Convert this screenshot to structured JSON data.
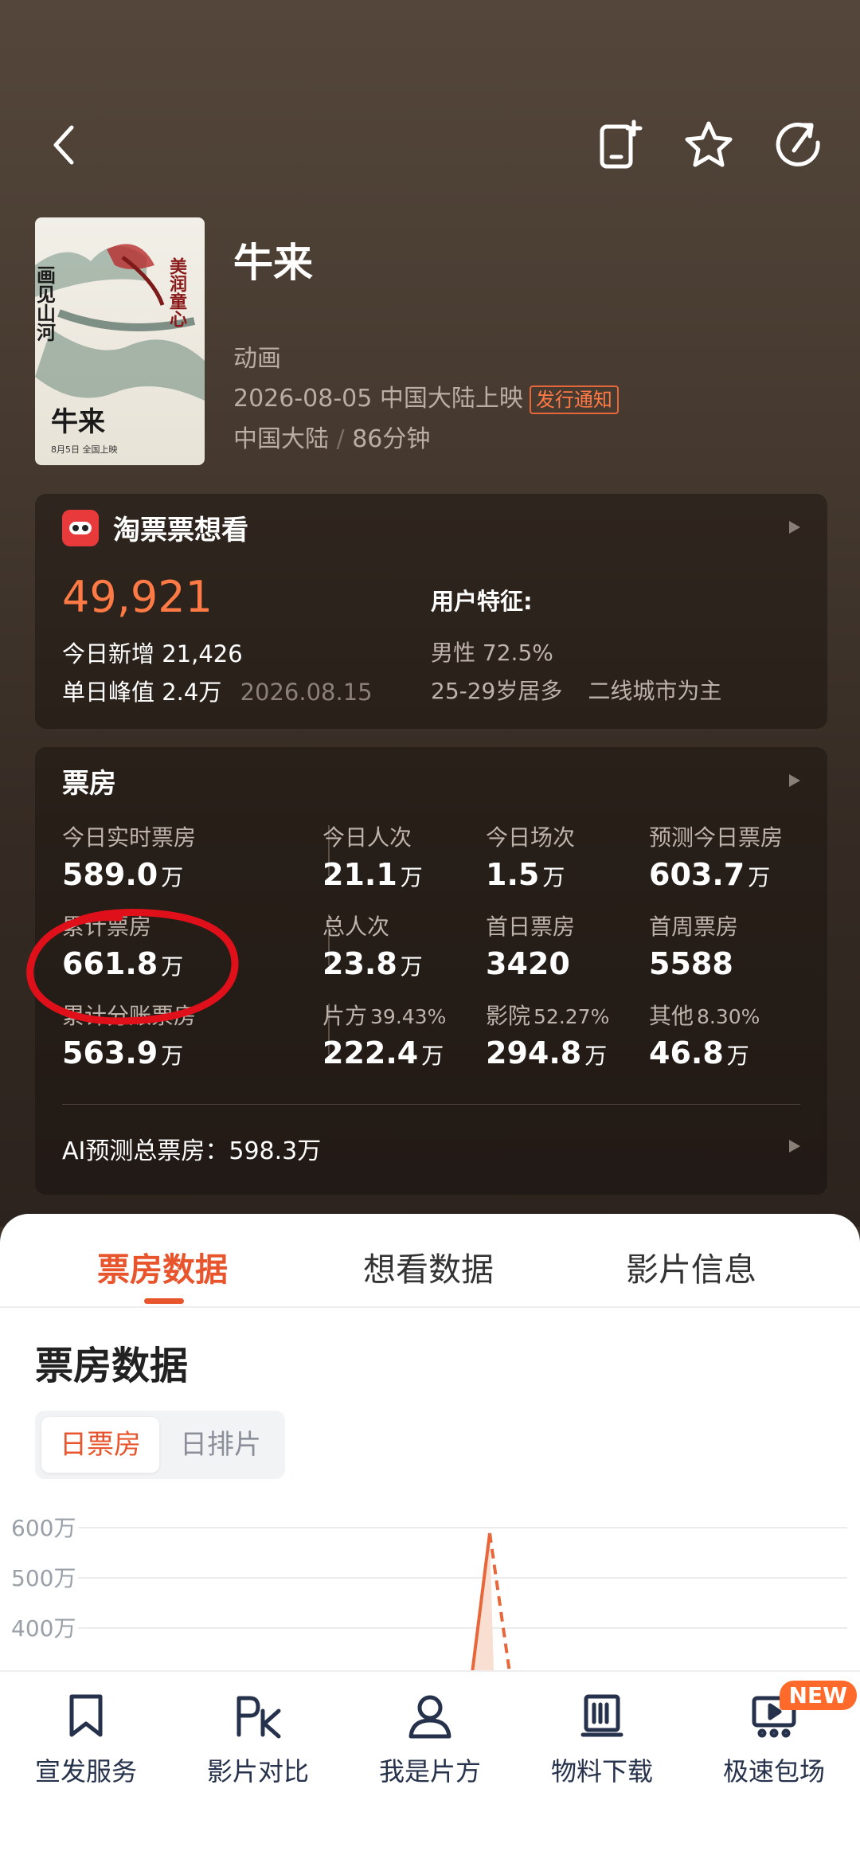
{
  "movie": {
    "title": "牛来",
    "genre": "动画",
    "release": "2026-08-05 中国大陆上映",
    "notice_badge": "发行通知",
    "region": "中国大陆",
    "region_sep": "/",
    "duration": "86分钟",
    "poster_text": {
      "left": "画见山河",
      "right": "美润童心",
      "title": "牛来",
      "date": "8月5日 全国上映"
    }
  },
  "want": {
    "title": "淘票票想看",
    "total": "49,921",
    "today_label": "今日新增",
    "today_value": "21,426",
    "peak_label": "单日峰值",
    "peak_value": "2.4万",
    "peak_date": "2026.08.15",
    "features_label": "用户特征:",
    "male_label": "男性",
    "male_value": "72.5%",
    "age": "25-29岁居多",
    "city": "二线城市为主"
  },
  "boxoffice": {
    "title": "票房",
    "stats": {
      "realtime": {
        "label": "今日实时票房",
        "value": "589.0",
        "unit": "万"
      },
      "today_people": {
        "label": "今日人次",
        "value": "21.1",
        "unit": "万"
      },
      "today_shows": {
        "label": "今日场次",
        "value": "1.5",
        "unit": "万"
      },
      "forecast_today": {
        "label": "预测今日票房",
        "value": "603.7",
        "unit": "万"
      },
      "cumulative": {
        "label": "累计票房",
        "value": "661.8",
        "unit": "万"
      },
      "total_people": {
        "label": "总人次",
        "value": "23.8",
        "unit": "万"
      },
      "first_day": {
        "label": "首日票房",
        "value": "3420"
      },
      "first_week": {
        "label": "首周票房",
        "value": "5588"
      },
      "split": {
        "label": "累计分账票房",
        "value": "563.9",
        "unit": "万"
      },
      "producer": {
        "label": "片方",
        "pct": "39.43%",
        "value": "222.4",
        "unit": "万"
      },
      "cinema": {
        "label": "影院",
        "pct": "52.27%",
        "value": "294.8",
        "unit": "万"
      },
      "other": {
        "label": "其他",
        "pct": "8.30%",
        "value": "46.8",
        "unit": "万"
      }
    },
    "ai_forecast": "AI预测总票房：598.3万"
  },
  "tabs": [
    "票房数据",
    "想看数据",
    "影片信息"
  ],
  "section_title": "票房数据",
  "segment": {
    "on": "日票房",
    "off": "日排片"
  },
  "chart_data": {
    "type": "line",
    "title": "",
    "xlabel": "",
    "ylabel": "",
    "y_ticks": [
      "600万",
      "500万",
      "400万"
    ],
    "ylim_visible": [
      350,
      600
    ],
    "y_unit": "万",
    "series": [
      {
        "style": "solid",
        "values": [
          589.0
        ]
      },
      {
        "style": "dashed",
        "values": [
          603.7
        ]
      }
    ],
    "accent_color": "#e8673a"
  },
  "bottom_nav": [
    {
      "label": "宣发服务",
      "icon": "bookmark-icon"
    },
    {
      "label": "影片对比",
      "icon": "pk-icon"
    },
    {
      "label": "我是片方",
      "icon": "user-icon"
    },
    {
      "label": "物料下载",
      "icon": "book-icon"
    },
    {
      "label": "极速包场",
      "icon": "screen-play-icon"
    }
  ],
  "new_badge": "NEW",
  "colors": {
    "accent": "#e8542b",
    "want_total": "#ff7a45",
    "annotation": "#e0101a"
  }
}
